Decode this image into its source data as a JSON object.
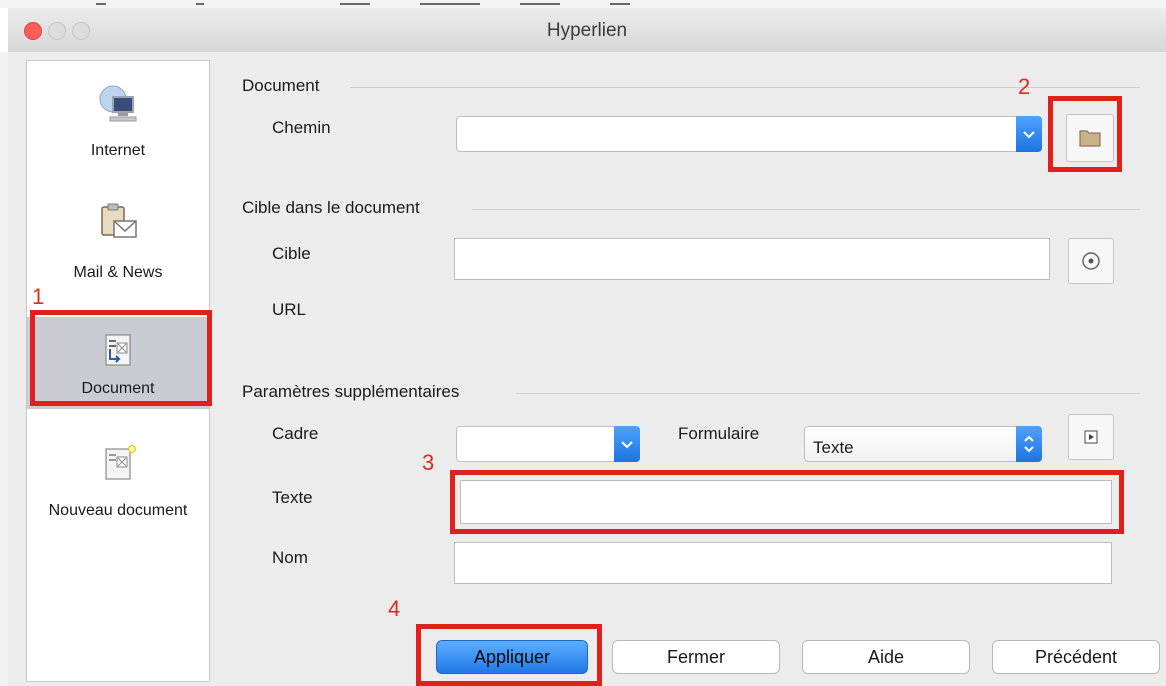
{
  "window": {
    "title": "Hyperlien"
  },
  "sidebar": {
    "items": [
      {
        "label": "Internet",
        "icon": "globe-computer-icon"
      },
      {
        "label": "Mail & News",
        "icon": "clipboard-mail-icon"
      },
      {
        "label": "Document",
        "icon": "document-target-icon",
        "selected": true
      },
      {
        "label": "Nouveau document",
        "icon": "new-document-icon"
      }
    ]
  },
  "document_section": {
    "heading": "Document",
    "path_label": "Chemin",
    "path_value": ""
  },
  "target_section": {
    "heading": "Cible dans le document",
    "target_label": "Cible",
    "target_value": "",
    "url_label": "URL"
  },
  "extra_section": {
    "heading": "Paramètres supplémentaires",
    "frame_label": "Cadre",
    "frame_value": "",
    "form_label": "Formulaire",
    "form_value": "Texte",
    "text_label": "Texte",
    "text_value": "",
    "name_label": "Nom",
    "name_value": ""
  },
  "buttons": {
    "apply": "Appliquer",
    "close": "Fermer",
    "help": "Aide",
    "previous": "Précédent"
  },
  "annotations": [
    "1",
    "2",
    "3",
    "4"
  ],
  "colors": {
    "highlight": "#e0201a",
    "accent_blue": "#1f78e6",
    "close_light": "#ff5f57"
  }
}
